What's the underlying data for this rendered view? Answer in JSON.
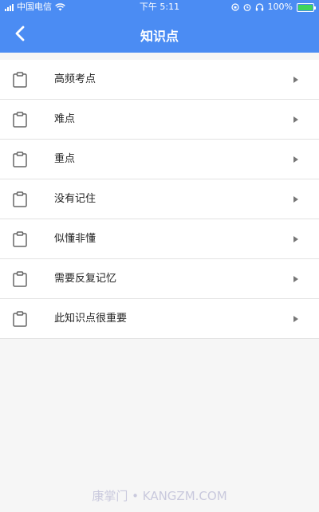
{
  "status_bar": {
    "carrier": "中国电信",
    "time": "下午 5:11",
    "battery": "100%",
    "battery_color": "#3fd45b"
  },
  "header": {
    "title": "知识点",
    "back_icon": "chevron-left-icon",
    "bg_color": "#4b8cf3"
  },
  "list": {
    "items": [
      {
        "label": "高频考点",
        "icon": "clipboard-icon"
      },
      {
        "label": "难点",
        "icon": "clipboard-icon"
      },
      {
        "label": "重点",
        "icon": "clipboard-icon"
      },
      {
        "label": "没有记住",
        "icon": "clipboard-icon"
      },
      {
        "label": "似懂非懂",
        "icon": "clipboard-icon"
      },
      {
        "label": "需要反复记忆",
        "icon": "clipboard-icon"
      },
      {
        "label": "此知识点很重要",
        "icon": "clipboard-icon"
      }
    ]
  },
  "watermark": "康掌门 • KANGZM.COM"
}
